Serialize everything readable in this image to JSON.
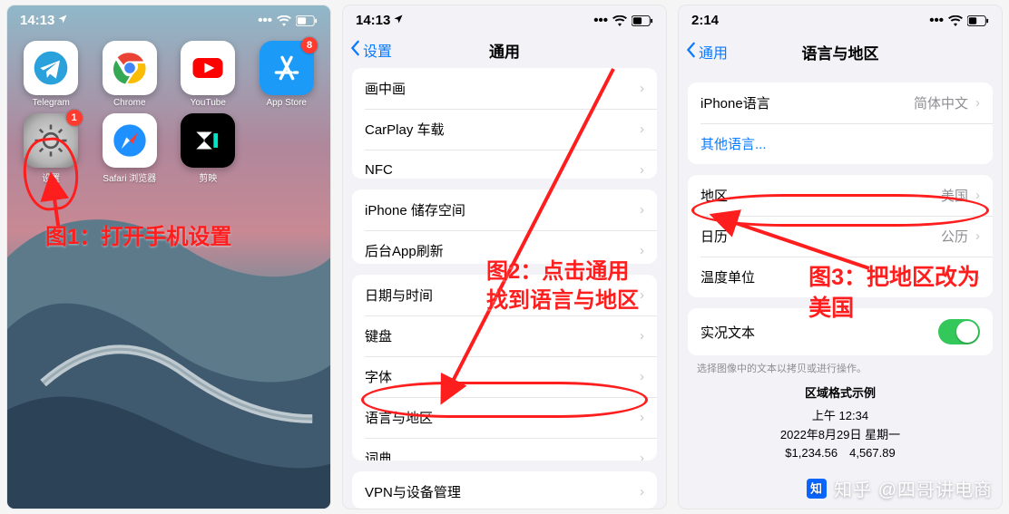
{
  "status_time": "14:13",
  "status_time_alt": "2:14",
  "annotations": {
    "a1": "图1：打开手机设置",
    "a2_l1": "图2：点击通用",
    "a2_l2": "找到语言与地区",
    "a3_l1": "图3：把地区改为",
    "a3_l2": "美国"
  },
  "phone1": {
    "apps": [
      {
        "name": "Telegram",
        "badge": ""
      },
      {
        "name": "Chrome",
        "badge": ""
      },
      {
        "name": "YouTube",
        "badge": ""
      },
      {
        "name": "App Store",
        "badge": "8"
      },
      {
        "name": "设置",
        "badge": "1"
      },
      {
        "name": "Safari 浏览器",
        "badge": ""
      },
      {
        "name": "剪映",
        "badge": ""
      }
    ]
  },
  "phone2": {
    "back": "设置",
    "title": "通用",
    "groups": [
      [
        {
          "label": "画中画"
        },
        {
          "label": "CarPlay 车载"
        },
        {
          "label": "NFC"
        }
      ],
      [
        {
          "label": "iPhone 储存空间"
        },
        {
          "label": "后台App刷新"
        }
      ],
      [
        {
          "label": "日期与时间"
        },
        {
          "label": "键盘"
        },
        {
          "label": "字体"
        },
        {
          "label": "语言与地区"
        },
        {
          "label": "词典"
        }
      ],
      [
        {
          "label": "VPN与设备管理"
        }
      ]
    ]
  },
  "phone3": {
    "back": "通用",
    "title": "语言与地区",
    "language_label": "iPhone语言",
    "language_value": "简体中文",
    "other_lang": "其他语言...",
    "region_label": "地区",
    "region_value": "美国",
    "calendar_label": "日历",
    "calendar_value": "公历",
    "temp_label": "温度单位",
    "livetext_label": "实况文本",
    "footer": "选择图像中的文本以拷贝或进行操作。",
    "example_hdr": "区域格式示例",
    "example_l1": "上午 12:34",
    "example_l2": "2022年8月29日 星期一",
    "example_l3": "$1,234.56　4,567.89"
  },
  "watermark": "知乎  @四哥讲电商"
}
